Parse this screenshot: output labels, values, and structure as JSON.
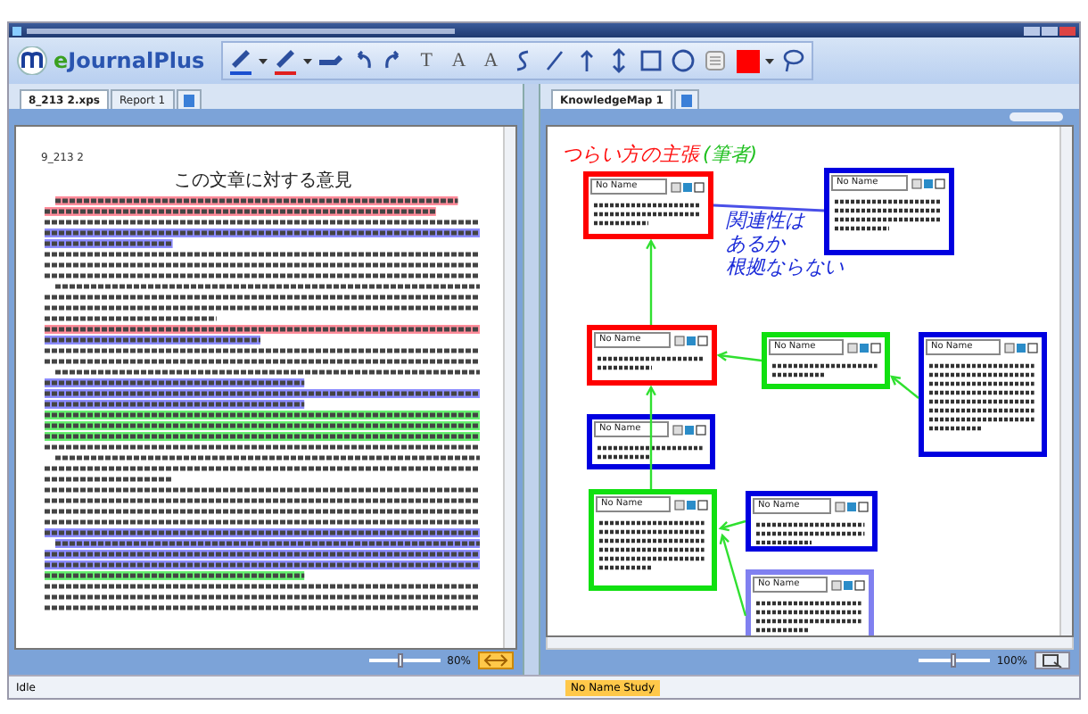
{
  "app": {
    "logo": "eJournalPlus"
  },
  "toolbar": [
    {
      "kind": "pen",
      "color": "#1a4fd0"
    },
    {
      "kind": "dropdown"
    },
    {
      "kind": "pen",
      "color": "#e02020"
    },
    {
      "kind": "dropdown"
    },
    {
      "kind": "highlighter"
    },
    {
      "kind": "undo"
    },
    {
      "kind": "redo"
    },
    {
      "kind": "text",
      "label": "T"
    },
    {
      "kind": "text",
      "label": "A"
    },
    {
      "kind": "text",
      "label": "A"
    },
    {
      "kind": "curve"
    },
    {
      "kind": "line"
    },
    {
      "kind": "arrow"
    },
    {
      "kind": "double-arrow"
    },
    {
      "kind": "rect"
    },
    {
      "kind": "circle"
    },
    {
      "kind": "note"
    },
    {
      "kind": "swatch",
      "color": "#ff0000"
    },
    {
      "kind": "dropdown"
    },
    {
      "kind": "lasso"
    }
  ],
  "left_pane": {
    "tabs": [
      {
        "label": "8_213 2.xps",
        "selected": true
      },
      {
        "label": "Report 1",
        "selected": false
      }
    ],
    "document": {
      "page_label": "9_213 2",
      "heading": "この文章に対する意見"
    },
    "zoom": {
      "level": 0.45,
      "reading": "80%"
    }
  },
  "right_pane": {
    "tabs": [
      {
        "label": "KnowledgeMap 1",
        "selected": true
      }
    ],
    "annotations": [
      {
        "text": "つらい方の主張",
        "color": "#ff1010"
      },
      {
        "text": "(筆者)",
        "color": "#20c020"
      }
    ],
    "note_lines": [
      "関連性は",
      "あるか",
      "根拠ならない"
    ],
    "nodes": [
      {
        "title": "No Name",
        "color": "#ff0000"
      },
      {
        "title": "No Name",
        "color": "#0000e0"
      },
      {
        "title": "No Name",
        "color": "#ff0000"
      },
      {
        "title": "No Name",
        "color": "#10e010"
      },
      {
        "title": "No Name",
        "color": "#0000e0"
      },
      {
        "title": "No Name",
        "color": "#0000e0"
      },
      {
        "title": "No Name",
        "color": "#10e010"
      },
      {
        "title": "No Name",
        "color": "#0000e0"
      },
      {
        "title": "No Name",
        "color": "#8080f0"
      }
    ],
    "zoom": {
      "level": 0.5,
      "reading": "100%"
    }
  },
  "status_bar": {
    "text": "Idle",
    "study_tab": "No Name Study"
  }
}
